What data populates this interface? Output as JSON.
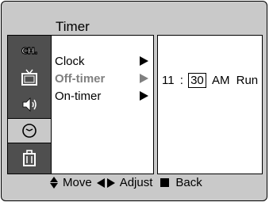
{
  "title": "Timer",
  "rail": {
    "items": [
      {
        "icon": "channel-icon",
        "label": "CH."
      },
      {
        "icon": "tv-icon"
      },
      {
        "icon": "speaker-icon"
      },
      {
        "icon": "clock-icon"
      },
      {
        "icon": "function-icon"
      }
    ]
  },
  "menu": {
    "items": [
      {
        "label": "Clock"
      },
      {
        "label": "Off-timer"
      },
      {
        "label": "On-timer"
      }
    ]
  },
  "value": {
    "hour": "11",
    "separator": ":",
    "minute": "30",
    "ampm": "AM",
    "state": "Run"
  },
  "bottombar": {
    "move_label": "Move",
    "adjust_label": "Adjust",
    "back_label": "Back"
  }
}
